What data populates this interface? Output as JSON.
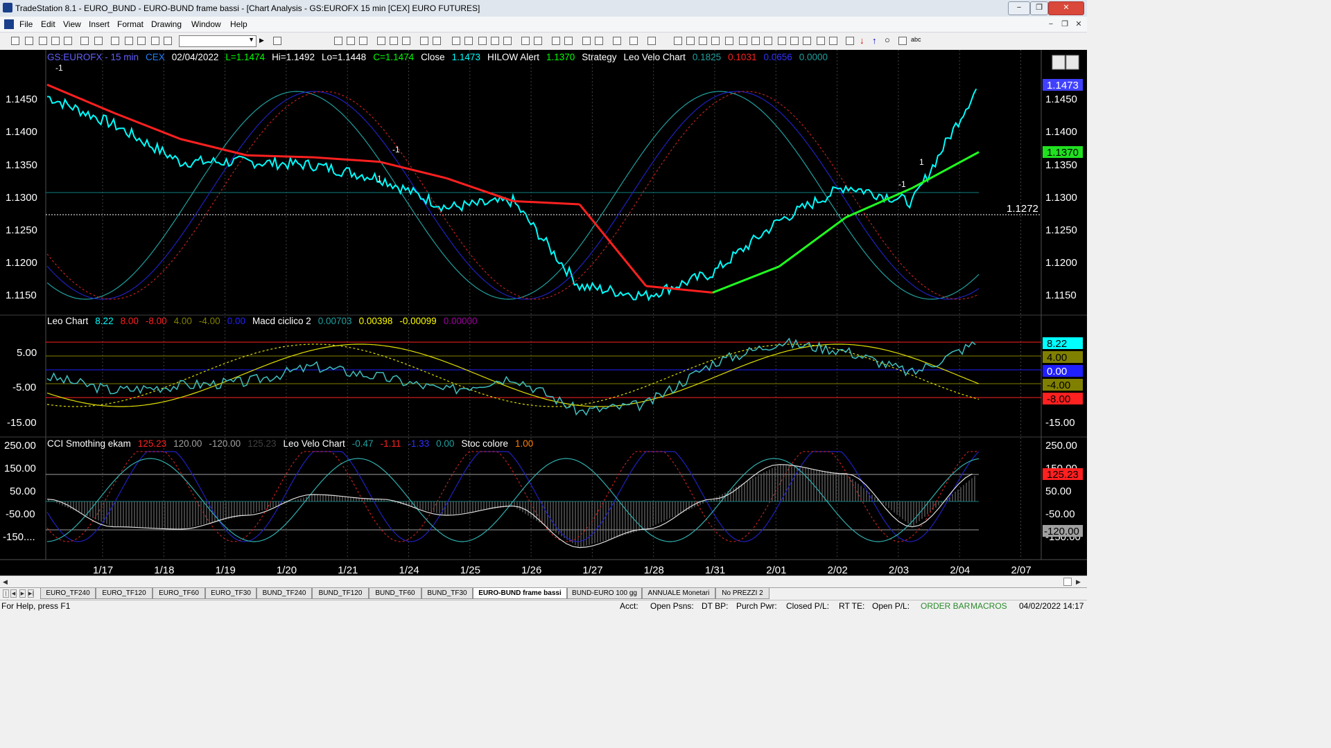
{
  "window": {
    "title": "TradeStation 8.1 - EURO_BUND - EURO-BUND frame bassi - [Chart Analysis - GS:EUROFX  15 min  [CEX] EURO FUTURES]",
    "controls": [
      "−",
      "❐",
      "✕"
    ]
  },
  "menu": {
    "items": [
      "File",
      "Edit",
      "View",
      "Insert",
      "Format",
      "Drawing",
      "Window",
      "Help"
    ]
  },
  "price_pane": {
    "header": [
      {
        "text": "GS:EUROFX - 15 min",
        "color": "#6060ff"
      },
      {
        "text": "CEX",
        "color": "#2080ff"
      },
      {
        "text": "02/04/2022",
        "color": "#ffffff"
      },
      {
        "text": "L=1.1474",
        "color": "#00ff00"
      },
      {
        "text": "Hi=1.1492",
        "color": "#ffffff"
      },
      {
        "text": "Lo=1.1448",
        "color": "#ffffff"
      },
      {
        "text": "C=1.1474",
        "color": "#00ff00"
      },
      {
        "text": "Close",
        "color": "#ffffff"
      },
      {
        "text": "1.1473",
        "color": "#00ffff"
      },
      {
        "text": "HILOW Alert",
        "color": "#ffffff"
      },
      {
        "text": "1.1370",
        "color": "#00ff00"
      },
      {
        "text": "Strategy",
        "color": "#ffffff"
      },
      {
        "text": "Leo Velo Chart",
        "color": "#ffffff"
      },
      {
        "text": "0.1825",
        "color": "#20a0a0"
      },
      {
        "text": "0.1031",
        "color": "#ff2020"
      },
      {
        "text": "0.0656",
        "color": "#3030ff"
      },
      {
        "text": "0.0000",
        "color": "#20a0a0"
      }
    ],
    "y_ticks": [
      "1.1450",
      "1.1400",
      "1.1350",
      "1.1300",
      "1.1250",
      "1.1200",
      "1.1150"
    ],
    "right_ticks": [
      "1.1450",
      "1.1400",
      "1.1350",
      "1.1300",
      "1.1250",
      "1.1200",
      "1.1150"
    ],
    "last_price": "1.1473",
    "alert_price": "1.1370",
    "dotted_level": "1.1272",
    "markers": [
      "-1",
      "-1",
      "1",
      "-1",
      "1"
    ]
  },
  "leo_pane": {
    "header": [
      {
        "text": "Leo Chart",
        "color": "#ffffff"
      },
      {
        "text": "8.22",
        "color": "#00ffff"
      },
      {
        "text": "8.00",
        "color": "#ff2020"
      },
      {
        "text": "-8.00",
        "color": "#ff2020"
      },
      {
        "text": "4.00",
        "color": "#808000"
      },
      {
        "text": "-4.00",
        "color": "#808000"
      },
      {
        "text": "0.00",
        "color": "#2020ff"
      },
      {
        "text": "Macd ciclico 2",
        "color": "#ffffff"
      },
      {
        "text": "0.00703",
        "color": "#20a0a0"
      },
      {
        "text": "0.00398",
        "color": "#ffff00"
      },
      {
        "text": "-0.00099",
        "color": "#ffff00"
      },
      {
        "text": "0.00000",
        "color": "#a000a0"
      }
    ],
    "y_ticks": [
      "5.00",
      "-5.00",
      "-15.00"
    ],
    "right_badges": [
      {
        "text": "8.22",
        "bg": "#00ffff",
        "fg": "#000000"
      },
      {
        "text": "4.00",
        "bg": "#808000",
        "fg": "#000000"
      },
      {
        "text": "0.00",
        "bg": "#2020ff",
        "fg": "#ffffff"
      },
      {
        "text": "-4.00",
        "bg": "#808000",
        "fg": "#000000"
      },
      {
        "text": "-8.00",
        "bg": "#ff2020",
        "fg": "#000000"
      }
    ],
    "right_ticks": [
      "-15.00"
    ]
  },
  "cci_pane": {
    "header": [
      {
        "text": "CCI Smothing ekam",
        "color": "#ffffff"
      },
      {
        "text": "125.23",
        "color": "#ff2020"
      },
      {
        "text": "120.00",
        "color": "#a0a0a0"
      },
      {
        "text": "-120.00",
        "color": "#a0a0a0"
      },
      {
        "text": "125.23",
        "color": "#404040"
      },
      {
        "text": "Leo Velo Chart",
        "color": "#ffffff"
      },
      {
        "text": "-0.47",
        "color": "#20a0a0"
      },
      {
        "text": "-1.11",
        "color": "#ff2020"
      },
      {
        "text": "-1.33",
        "color": "#3030ff"
      },
      {
        "text": "0.00",
        "color": "#20a0a0"
      },
      {
        "text": "Stoc colore",
        "color": "#ffffff"
      },
      {
        "text": "1.00",
        "color": "#ff8000"
      }
    ],
    "y_ticks": [
      "250.00",
      "150.00",
      "50.00",
      "-50.00",
      "-150...."
    ],
    "right_ticks": [
      "250.00",
      "150.00",
      "50.00",
      "-50.00",
      "-150.00"
    ],
    "right_badges": [
      {
        "text": "125.23",
        "bg": "#ff2020",
        "fg": "#000000"
      },
      {
        "text": "-120.00",
        "bg": "#a0a0a0",
        "fg": "#000000"
      }
    ]
  },
  "x_axis": {
    "labels": [
      "1/17",
      "1/18",
      "1/19",
      "1/20",
      "1/21",
      "1/24",
      "1/25",
      "1/26",
      "1/27",
      "1/28",
      "1/31",
      "2/01",
      "2/02",
      "2/03",
      "2/04",
      "2/07"
    ]
  },
  "chart_data": [
    {
      "type": "line",
      "title": "GS:EUROFX - 15 min",
      "xlabel": "",
      "ylabel": "",
      "categories": [
        "1/17",
        "1/18",
        "1/19",
        "1/20",
        "1/21",
        "1/24",
        "1/25",
        "1/26",
        "1/27",
        "1/28",
        "1/31",
        "2/01",
        "2/02",
        "2/03",
        "2/04"
      ],
      "ylim": [
        1.113,
        1.149
      ],
      "series": [
        {
          "name": "Close",
          "values": [
            1.1455,
            1.1412,
            1.1355,
            1.1355,
            1.135,
            1.133,
            1.1285,
            1.1295,
            1.1165,
            1.115,
            1.1185,
            1.1265,
            1.1318,
            1.1293,
            1.1473
          ]
        },
        {
          "name": "HILOW Alert",
          "values": [
            1.1473,
            1.143,
            1.139,
            1.1365,
            1.1362,
            1.1355,
            1.133,
            1.1295,
            1.129,
            1.1165,
            1.1155,
            1.1195,
            1.127,
            1.1315,
            1.137
          ]
        }
      ],
      "reference_lines": [
        1.1307,
        1.1272
      ]
    },
    {
      "type": "line",
      "title": "Leo Chart / Macd ciclico 2",
      "categories": [
        "1/17",
        "1/18",
        "1/19",
        "1/20",
        "1/21",
        "1/24",
        "1/25",
        "1/26",
        "1/27",
        "1/28",
        "1/31",
        "2/01",
        "2/02",
        "2/03",
        "2/04"
      ],
      "ylim": [
        -20,
        12
      ],
      "series": [
        {
          "name": "Leo Chart",
          "values": [
            -2.0,
            -6.0,
            -4.5,
            -3.5,
            1.0,
            -2.0,
            -6.0,
            -2.0,
            -12.0,
            -10.0,
            2.0,
            8.0,
            5.5,
            -1.0,
            8.22
          ]
        }
      ],
      "reference_lines": [
        8.0,
        4.0,
        0.0,
        -4.0,
        -8.0
      ]
    },
    {
      "type": "line",
      "title": "CCI Smothing ekam / Leo Velo Chart / Stoc colore",
      "categories": [
        "1/17",
        "1/18",
        "1/19",
        "1/20",
        "1/21",
        "1/24",
        "1/25",
        "1/26",
        "1/27",
        "1/28",
        "1/31",
        "2/01",
        "2/02",
        "2/03",
        "2/04"
      ],
      "ylim": [
        -210,
        260
      ],
      "series": [
        {
          "name": "CCI Smothing ekam",
          "values": [
            10,
            -110,
            -120,
            -60,
            30,
            10,
            -60,
            -20,
            -200,
            -120,
            10,
            160,
            120,
            -110,
            125.23
          ]
        }
      ],
      "reference_lines": [
        120,
        -120
      ]
    }
  ],
  "sheet_tabs": [
    "EURO_TF240",
    "EURO_TF120",
    "EURO_TF60",
    "EURO_TF30",
    "BUND_TF240",
    "BUND_TF120",
    "BUND_TF60",
    "BUND_TF30",
    "EURO-BUND frame bassi",
    "BUND-EURO 100 gg",
    "ANNUALE Monetari",
    "No PREZZI 2"
  ],
  "active_tab": "EURO-BUND frame bassi",
  "status": {
    "help": "For Help, press F1",
    "acct": "Acct:",
    "open_psns": "Open Psns:",
    "dt_bp": "DT BP:",
    "purch_pwr": "Purch Pwr:",
    "closed_pl": "Closed P/L:",
    "rt_te": "RT TE:",
    "open_pl": "Open P/L:",
    "order_bar": "ORDER BAR",
    "macros": "MACROS",
    "datetime": "04/02/2022 14:17"
  },
  "colors": {
    "chart_bg": "#000000",
    "price_line": "#00ffff",
    "alert_red": "#ff2020",
    "alert_green": "#20ff20",
    "wave_teal": "#20a0a0",
    "wave_blue": "#2020c0"
  }
}
